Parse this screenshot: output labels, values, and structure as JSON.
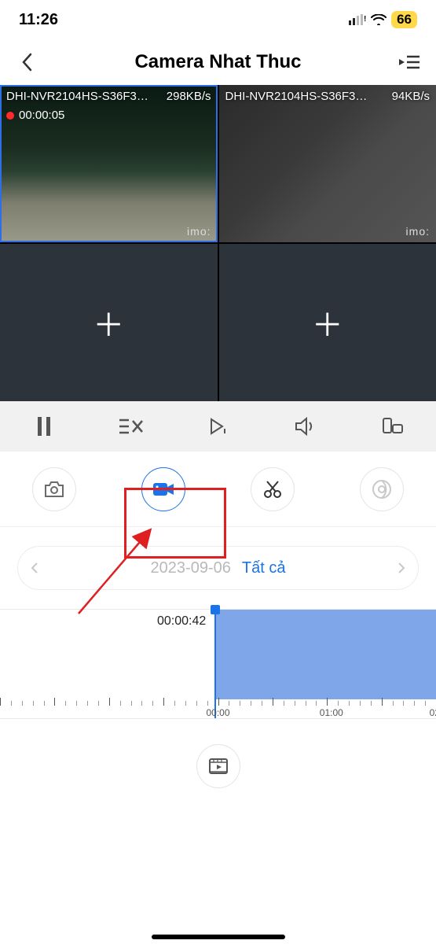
{
  "status": {
    "time": "11:26",
    "battery": "66"
  },
  "header": {
    "title": "Camera Nhat Thuc"
  },
  "tiles": [
    {
      "name": "DHI-NVR2104HS-S36F3…",
      "rate": "298KB/s",
      "rec_time": "00:00:05",
      "brand": "imo:"
    },
    {
      "name": "DHI-NVR2104HS-S36F3…",
      "rate": "94KB/s",
      "brand": "imo:"
    }
  ],
  "date_picker": {
    "date": "2023-09-06",
    "filter": "Tất cả"
  },
  "timeline": {
    "current": "00:00:42",
    "ticks": [
      {
        "label": "00:00",
        "pct": 50
      },
      {
        "label": "01:00",
        "pct": 76
      },
      {
        "label": "02:",
        "pct": 100
      }
    ]
  }
}
